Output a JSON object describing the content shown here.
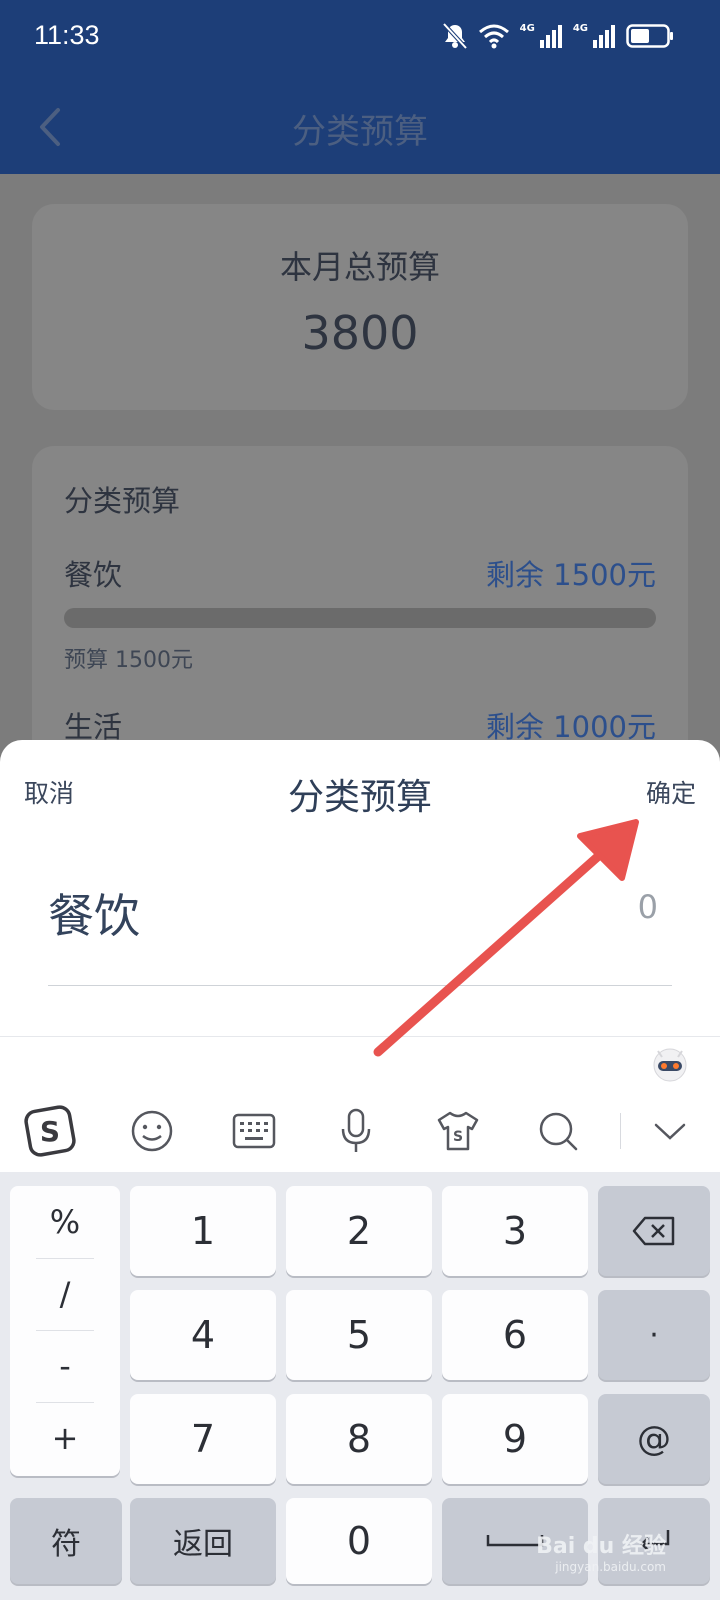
{
  "status_bar": {
    "time": "11:33",
    "network_1": "4G",
    "network_2": "4G"
  },
  "app_bar": {
    "title": "分类预算"
  },
  "summary_card": {
    "label": "本月总预算",
    "value": "3800"
  },
  "categories_card": {
    "title": "分类预算",
    "items": [
      {
        "name": "餐饮",
        "remaining": "剩余 1500元",
        "budget": "预算 1500元"
      },
      {
        "name": "生活",
        "remaining": "剩余 1000元"
      }
    ]
  },
  "sheet": {
    "cancel_label": "取消",
    "title": "分类预算",
    "confirm_label": "确定",
    "category": "餐饮",
    "amount": "0"
  },
  "keyboard": {
    "symbols": [
      "%",
      "/",
      "-",
      "+"
    ],
    "digits": [
      "1",
      "2",
      "3",
      "4",
      "5",
      "6",
      "7",
      "8",
      "9"
    ],
    "dot": "·",
    "at": "@",
    "symbol_key": "符",
    "back_key": "返回",
    "zero": "0"
  },
  "watermark": {
    "brand": "Bai du 经验",
    "url": "jingyan.baidu.com"
  },
  "colors": {
    "app_bar": "#1d3e78",
    "accent_text": "#2c4f8c",
    "arrow": "#e8534f"
  }
}
